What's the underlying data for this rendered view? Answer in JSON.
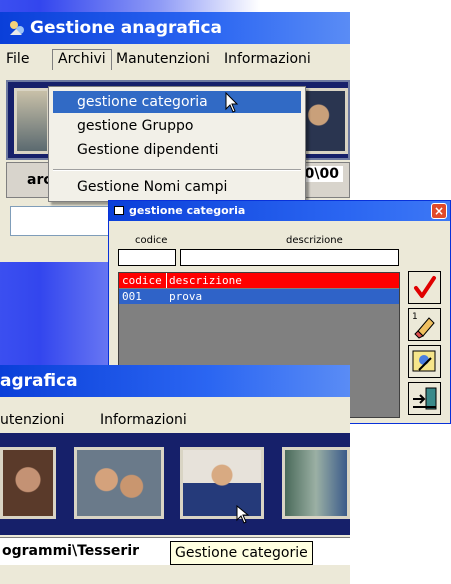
{
  "window_main": {
    "title": "Gestione anagrafica",
    "menu": [
      "File",
      "Archivi",
      "Manutenzioni",
      "Informazioni"
    ],
    "status_left": "arc",
    "status_right": ".0\\00"
  },
  "archivi_menu": {
    "items": [
      "gestione categoria",
      "gestione Gruppo",
      "Gestione dipendenti",
      "Gestione Nomi campi"
    ],
    "selected": "gestione categoria"
  },
  "dialog": {
    "title": "gestione categoria",
    "close_label": "×",
    "codice_label": "codice",
    "descrizione_label": "descrizione",
    "grid": {
      "columns": [
        "codice",
        "descrizione"
      ],
      "rows": [
        [
          "001",
          "prova"
        ]
      ]
    },
    "buttons": [
      "confirm-check-icon",
      "eraser-icon",
      "edit-icon",
      "exit-icon"
    ]
  },
  "window_zoom": {
    "title": "agrafica",
    "menu": [
      "utenzioni",
      "Informazioni"
    ],
    "status_text": "ogrammi\\Tesserir",
    "tooltip": "Gestione categorie"
  },
  "colors": {
    "titlebar": "#0a3fd9",
    "selection": "#316ac5",
    "grid_header": "#ff0000",
    "grid_row": "#2f63c8",
    "photo_strip": "#16206a"
  }
}
